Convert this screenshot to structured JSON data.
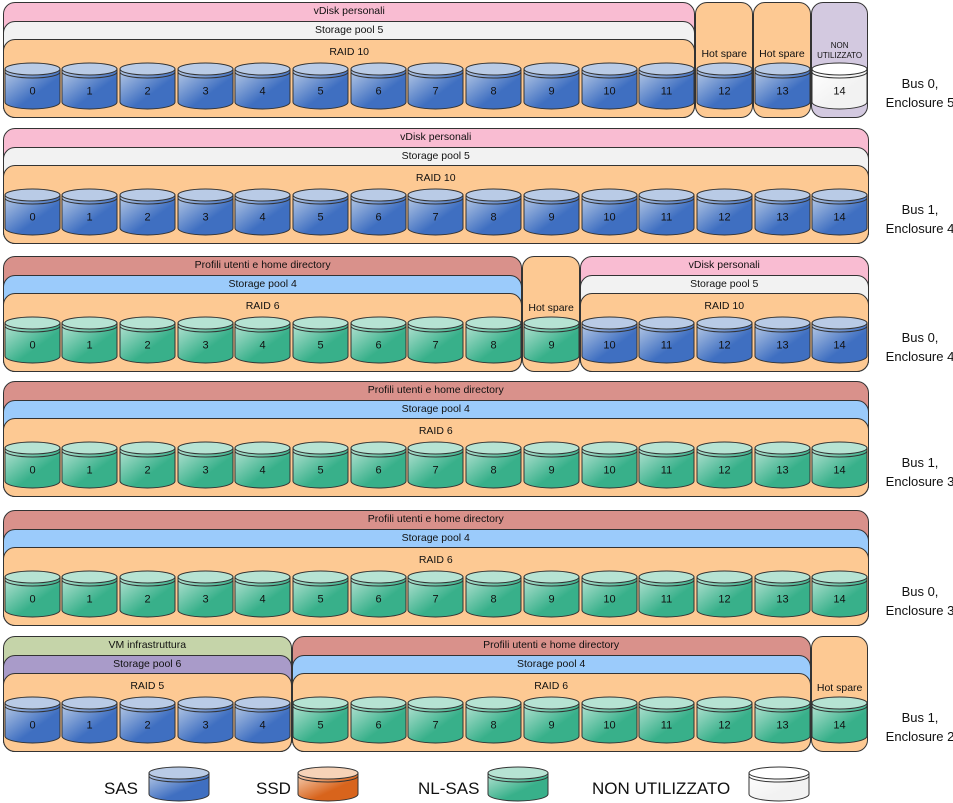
{
  "colors": {
    "SAS": [
      "#b9cbe6",
      "#3f6fc1"
    ],
    "SSD": [
      "#f6d3b8",
      "#d8641c"
    ],
    "NL-SAS": [
      "#b6e3d3",
      "#38b08a"
    ],
    "UNUSED": [
      "#ffffff",
      "#f2f2f2"
    ]
  },
  "rows": [
    {
      "label": [
        "Bus 0,",
        "Enclosure 5"
      ],
      "groups": [
        {
          "type": "stack",
          "from": 0,
          "to": 11,
          "layers": [
            {
              "label": "vDisk personali",
              "color": "#f9bcd2"
            },
            {
              "label": "Storage pool 5",
              "color": "#f2f2f2"
            },
            {
              "label": "RAID 10",
              "color": "#fdc993"
            }
          ]
        },
        {
          "type": "column",
          "from": 12,
          "to": 12,
          "label": "Hot spare",
          "color": "#fdc993"
        },
        {
          "type": "column",
          "from": 13,
          "to": 13,
          "label": "Hot spare",
          "color": "#fdc993"
        },
        {
          "type": "column",
          "from": 14,
          "to": 14,
          "label": "NON UTILIZZATO",
          "color": "#d3c9e0",
          "small": true
        }
      ],
      "disks": [
        "SAS",
        "SAS",
        "SAS",
        "SAS",
        "SAS",
        "SAS",
        "SAS",
        "SAS",
        "SAS",
        "SAS",
        "SAS",
        "SAS",
        "SAS",
        "SAS",
        "UNUSED"
      ]
    },
    {
      "label": [
        "Bus 1,",
        "Enclosure 4"
      ],
      "groups": [
        {
          "type": "stack",
          "from": 0,
          "to": 14,
          "layers": [
            {
              "label": "vDisk personali",
              "color": "#f9bcd2"
            },
            {
              "label": "Storage pool 5",
              "color": "#f2f2f2"
            },
            {
              "label": "RAID 10",
              "color": "#fdc993"
            }
          ]
        }
      ],
      "disks": [
        "SAS",
        "SAS",
        "SAS",
        "SAS",
        "SAS",
        "SAS",
        "SAS",
        "SAS",
        "SAS",
        "SAS",
        "SAS",
        "SAS",
        "SAS",
        "SAS",
        "SAS"
      ]
    },
    {
      "label": [
        "Bus 0,",
        "Enclosure 4"
      ],
      "groups": [
        {
          "type": "stack",
          "from": 0,
          "to": 8,
          "layers": [
            {
              "label": "Profili utenti e home directory",
              "color": "#d9918b"
            },
            {
              "label": "Storage pool 4",
              "color": "#9bcbfb"
            },
            {
              "label": "RAID 6",
              "color": "#fdc993"
            }
          ]
        },
        {
          "type": "column",
          "from": 9,
          "to": 9,
          "label": "Hot spare",
          "color": "#fdc993"
        },
        {
          "type": "stack",
          "from": 10,
          "to": 14,
          "layers": [
            {
              "label": "vDisk personali",
              "color": "#f9bcd2"
            },
            {
              "label": "Storage pool 5",
              "color": "#f2f2f2"
            },
            {
              "label": "RAID 10",
              "color": "#fdc993"
            }
          ]
        }
      ],
      "disks": [
        "NL-SAS",
        "NL-SAS",
        "NL-SAS",
        "NL-SAS",
        "NL-SAS",
        "NL-SAS",
        "NL-SAS",
        "NL-SAS",
        "NL-SAS",
        "NL-SAS",
        "SAS",
        "SAS",
        "SAS",
        "SAS",
        "SAS"
      ]
    },
    {
      "label": [
        "Bus 1,",
        "Enclosure 3"
      ],
      "groups": [
        {
          "type": "stack",
          "from": 0,
          "to": 14,
          "layers": [
            {
              "label": "Profili utenti e home directory",
              "color": "#d9918b"
            },
            {
              "label": "Storage pool 4",
              "color": "#9bcbfb"
            },
            {
              "label": "RAID 6",
              "color": "#fdc993"
            }
          ]
        }
      ],
      "disks": [
        "NL-SAS",
        "NL-SAS",
        "NL-SAS",
        "NL-SAS",
        "NL-SAS",
        "NL-SAS",
        "NL-SAS",
        "NL-SAS",
        "NL-SAS",
        "NL-SAS",
        "NL-SAS",
        "NL-SAS",
        "NL-SAS",
        "NL-SAS",
        "NL-SAS"
      ]
    },
    {
      "label": [
        "Bus 0,",
        "Enclosure 3"
      ],
      "groups": [
        {
          "type": "stack",
          "from": 0,
          "to": 14,
          "layers": [
            {
              "label": "Profili utenti e home directory",
              "color": "#d9918b"
            },
            {
              "label": "Storage pool 4",
              "color": "#9bcbfb"
            },
            {
              "label": "RAID 6",
              "color": "#fdc993"
            }
          ]
        }
      ],
      "disks": [
        "NL-SAS",
        "NL-SAS",
        "NL-SAS",
        "NL-SAS",
        "NL-SAS",
        "NL-SAS",
        "NL-SAS",
        "NL-SAS",
        "NL-SAS",
        "NL-SAS",
        "NL-SAS",
        "NL-SAS",
        "NL-SAS",
        "NL-SAS",
        "NL-SAS"
      ]
    },
    {
      "label": [
        "Bus 1,",
        "Enclosure 2"
      ],
      "groups": [
        {
          "type": "stack",
          "from": 0,
          "to": 4,
          "layers": [
            {
              "label": "VM infrastruttura",
              "color": "#c5d4a9"
            },
            {
              "label": "Storage pool 6",
              "color": "#a99bc9"
            },
            {
              "label": "RAID 5",
              "color": "#fdc993"
            }
          ]
        },
        {
          "type": "stack",
          "from": 5,
          "to": 13,
          "layers": [
            {
              "label": "Profili utenti e home directory",
              "color": "#d9918b"
            },
            {
              "label": "Storage pool 4",
              "color": "#9bcbfb"
            },
            {
              "label": "RAID 6",
              "color": "#fdc993"
            }
          ]
        },
        {
          "type": "column",
          "from": 14,
          "to": 14,
          "label": "Hot spare",
          "color": "#fdc993"
        }
      ],
      "disks": [
        "SAS",
        "SAS",
        "SAS",
        "SAS",
        "SAS",
        "NL-SAS",
        "NL-SAS",
        "NL-SAS",
        "NL-SAS",
        "NL-SAS",
        "NL-SAS",
        "NL-SAS",
        "NL-SAS",
        "NL-SAS",
        "NL-SAS"
      ]
    }
  ],
  "legend": [
    {
      "label": "SAS",
      "type": "SAS"
    },
    {
      "label": "SSD",
      "type": "SSD"
    },
    {
      "label": "NL-SAS",
      "type": "NL-SAS"
    },
    {
      "label": "NON UTILIZZATO",
      "type": "UNUSED"
    }
  ]
}
